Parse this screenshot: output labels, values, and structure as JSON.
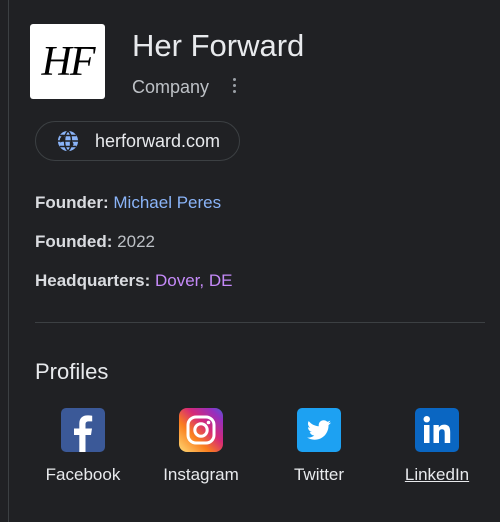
{
  "company": {
    "logo_text": "HF",
    "name": "Her Forward",
    "type": "Company"
  },
  "website": {
    "label": "herforward.com",
    "icon": "globe-icon"
  },
  "facts": [
    {
      "label": "Founder:",
      "value": "Michael Peres",
      "style": "link"
    },
    {
      "label": "Founded:",
      "value": "2022",
      "style": "text"
    },
    {
      "label": "Headquarters:",
      "value": "Dover, DE",
      "style": "visited-link"
    }
  ],
  "profiles": {
    "title": "Profiles",
    "items": [
      {
        "label": "Facebook",
        "icon": "facebook-icon",
        "color": "#3b5998"
      },
      {
        "label": "Instagram",
        "icon": "instagram-icon",
        "color": "#c13584"
      },
      {
        "label": "Twitter",
        "icon": "twitter-icon",
        "color": "#1da1f2"
      },
      {
        "label": "LinkedIn",
        "icon": "linkedin-icon",
        "color": "#0a66c2"
      }
    ]
  },
  "colors": {
    "background": "#202124",
    "link": "#8ab4f8",
    "visited": "#c58af9"
  }
}
